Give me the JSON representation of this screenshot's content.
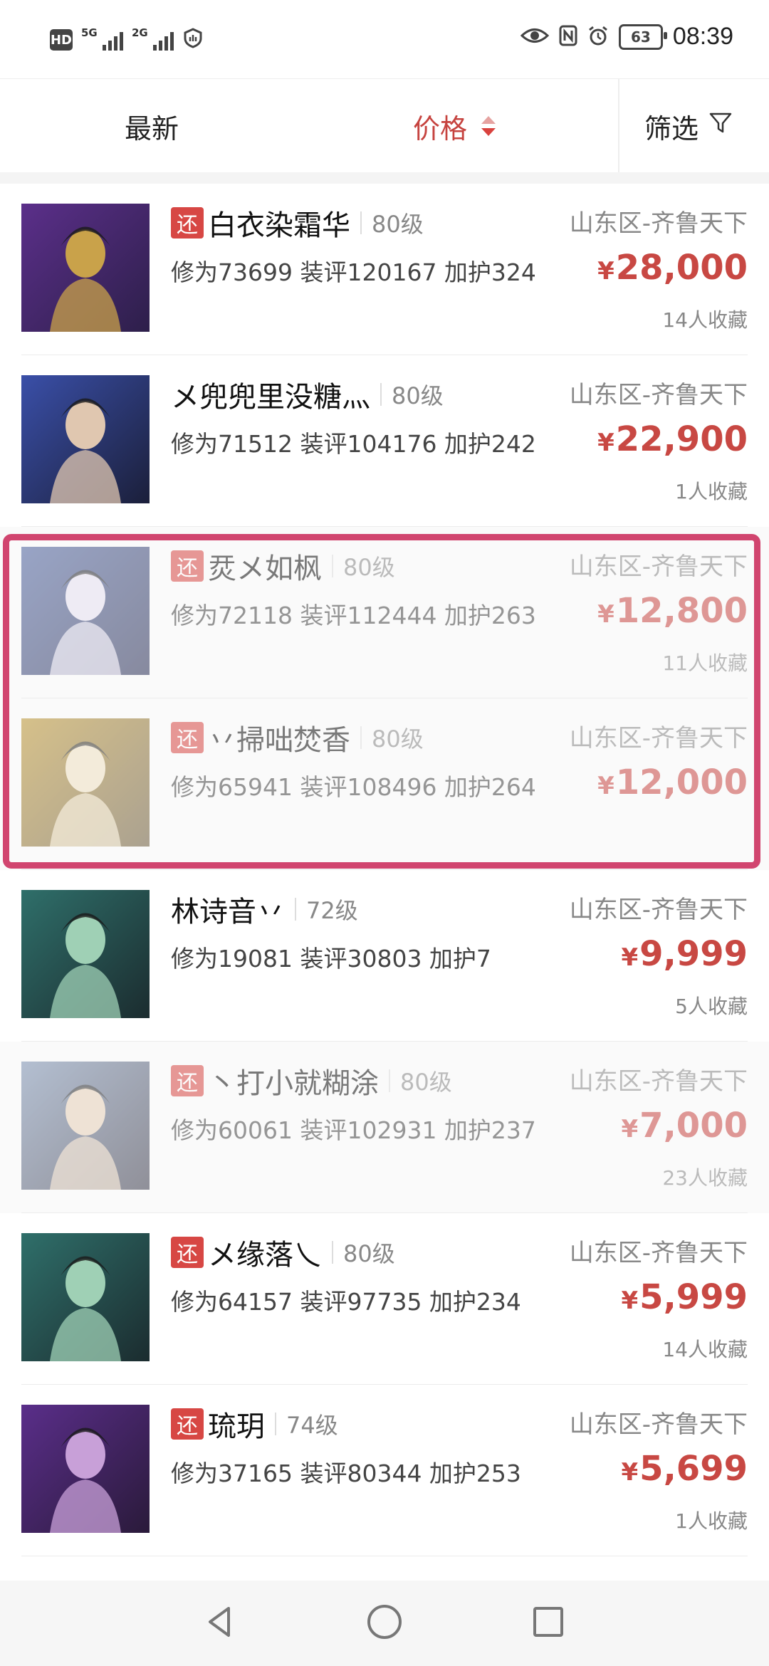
{
  "status_bar": {
    "network_left": "HD",
    "sim1_tech": "5G",
    "sim2_tech": "2G",
    "battery": "63",
    "time": "08:39"
  },
  "filter_bar": {
    "latest": "最新",
    "price": "价格",
    "filter": "筛选"
  },
  "listings": [
    {
      "refund": true,
      "name": "白衣染霜华",
      "level": "80级",
      "stats": "修为73699 装评120167 加护324",
      "server": "山东区-齐鲁天下",
      "price": "28,000",
      "favs": "14人收藏",
      "faded": false,
      "palette": [
        "#5b2f8a",
        "#c9a24a",
        "#2d1f4a"
      ]
    },
    {
      "refund": false,
      "name": "メ兜兜里没糖灬",
      "level": "80级",
      "stats": "修为71512 装评104176 加护242",
      "server": "山东区-齐鲁天下",
      "price": "22,900",
      "favs": "1人收藏",
      "faded": false,
      "palette": [
        "#3a4fa8",
        "#e0c7b0",
        "#1b1f3a"
      ]
    },
    {
      "refund": true,
      "name": "烎メ如枫",
      "level": "80级",
      "stats": "修为72118 装评112444 加护263",
      "server": "山东区-齐鲁天下",
      "price": "12,800",
      "favs": "11人收藏",
      "faded": true,
      "palette": [
        "#4a5f9c",
        "#e6e0f0",
        "#2a2f55"
      ]
    },
    {
      "refund": true,
      "name": "丷掃咄焚香",
      "level": "80级",
      "stats": "修为65941 装评108496 加护264",
      "server": "山东区-齐鲁天下",
      "price": "12,000",
      "favs": "",
      "faded": true,
      "palette": [
        "#b9922f",
        "#efe0c0",
        "#6b5a3a"
      ]
    },
    {
      "refund": false,
      "name": "林诗音丷",
      "level": "72级",
      "stats": "修为19081 装评30803 加护7",
      "server": "山东区-齐鲁天下",
      "price": "9,999",
      "favs": "5人收藏",
      "faded": false,
      "palette": [
        "#2f6f6a",
        "#9fd0b5",
        "#1b2c2f"
      ]
    },
    {
      "refund": true,
      "name": "丶打小就糊涂",
      "level": "80级",
      "stats": "修为60061 装评102931 加护237",
      "server": "山东区-齐鲁天下",
      "price": "7,000",
      "favs": "23人收藏",
      "faded": true,
      "palette": [
        "#7a8fb0",
        "#e6d0b8",
        "#3a3a4a"
      ]
    },
    {
      "refund": true,
      "name": "メ缘落乀",
      "level": "80级",
      "stats": "修为64157 装评97735 加护234",
      "server": "山东区-齐鲁天下",
      "price": "5,999",
      "favs": "14人收藏",
      "faded": false,
      "palette": [
        "#2f6f6a",
        "#9fd0b5",
        "#1b2c2f"
      ]
    },
    {
      "refund": true,
      "name": "琉玥",
      "level": "74级",
      "stats": "修为37165 装评80344 加护253",
      "server": "山东区-齐鲁天下",
      "price": "5,699",
      "favs": "1人收藏",
      "faded": false,
      "palette": [
        "#5a2e8a",
        "#c8a0d8",
        "#2a1a3a"
      ]
    }
  ],
  "labels": {
    "refund": "还",
    "currency": "¥"
  },
  "colors": {
    "accent": "#c84843",
    "highlight_border": "#d1456f"
  }
}
